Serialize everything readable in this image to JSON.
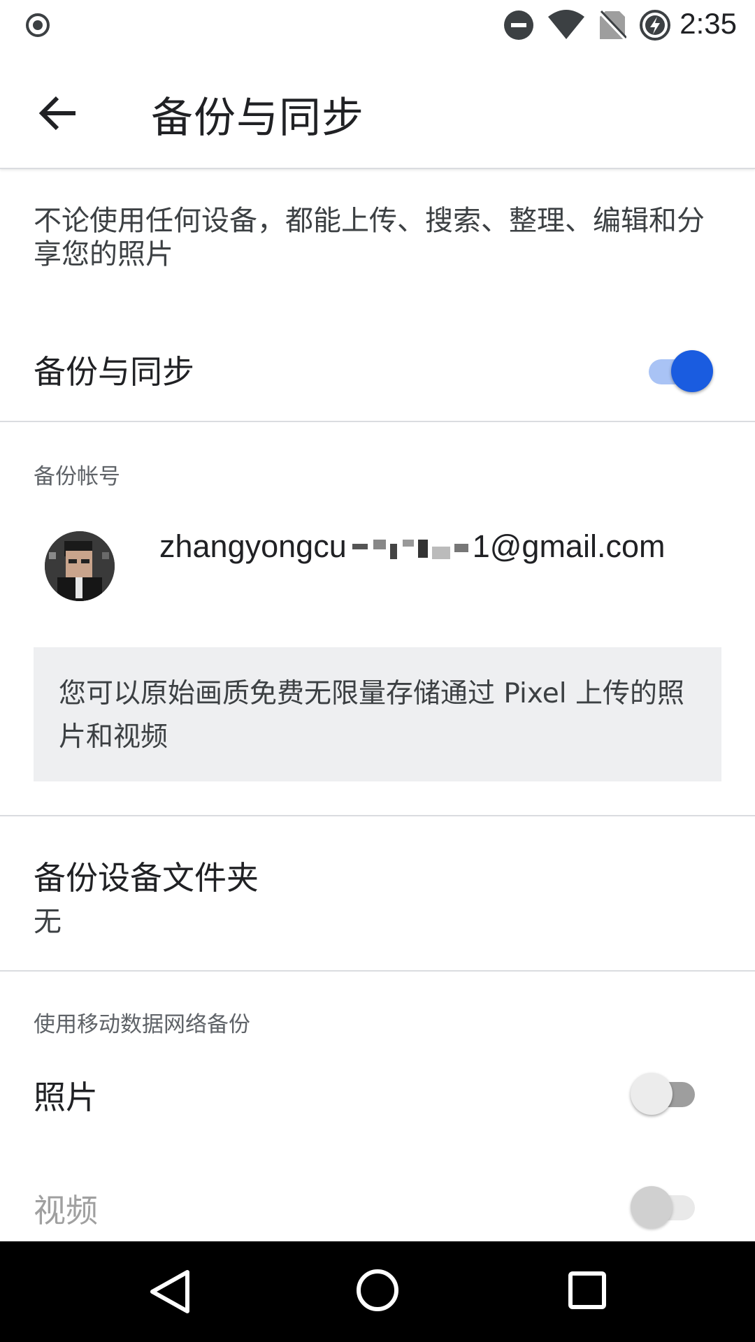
{
  "status_bar": {
    "time": "2:35",
    "icons": [
      "record-icon",
      "do-not-disturb-icon",
      "wifi-icon",
      "no-sim-icon",
      "battery-charging-icon"
    ]
  },
  "app_bar": {
    "title": "备份与同步",
    "back_icon": "arrow-back-icon"
  },
  "description": "不论使用任何设备，都能上传、搜索、整理、编辑和分享您的照片",
  "backup_sync": {
    "label": "备份与同步",
    "enabled": true
  },
  "account_section": {
    "header": "备份帐号",
    "email": "zhangyongcu    1@gmail.com",
    "info": "您可以原始画质免费无限量存储通过 Pixel 上传的照片和视频"
  },
  "device_folders": {
    "title": "备份设备文件夹",
    "value": "无"
  },
  "mobile_data_section": {
    "header": "使用移动数据网络备份",
    "photos_label": "照片",
    "photos_enabled": false,
    "videos_label": "视频",
    "videos_enabled": false
  },
  "colors": {
    "accent": "#1a5ce0",
    "accent_track": "#a9c3f5",
    "off_thumb": "#ececec",
    "off_track": "#9e9e9e"
  },
  "nav_bar": {
    "icons": [
      "nav-back-icon",
      "nav-home-icon",
      "nav-recents-icon"
    ]
  }
}
